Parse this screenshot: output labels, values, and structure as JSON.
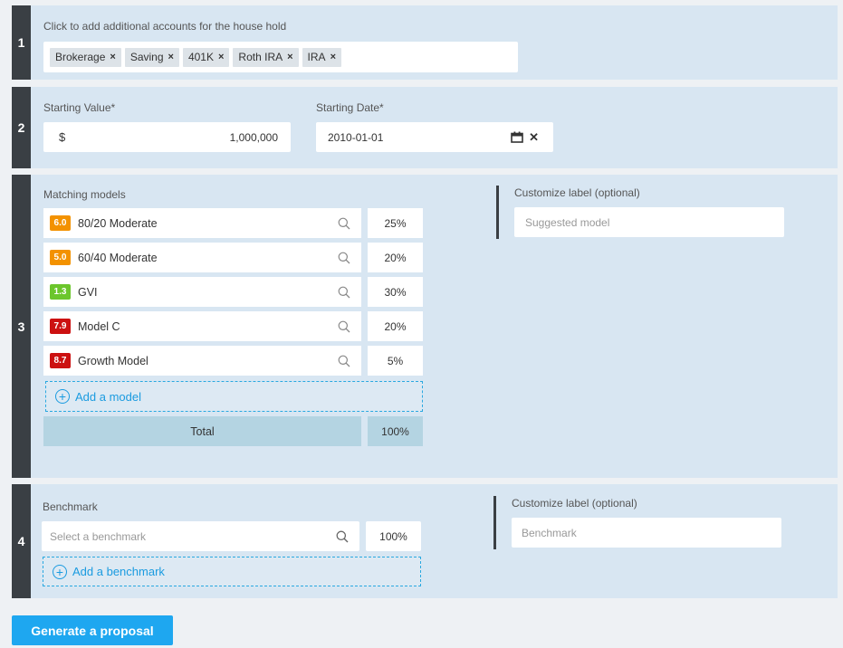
{
  "section1": {
    "step": "1",
    "label": "Click to add additional accounts for the house hold",
    "chips": [
      {
        "label": "Brokerage"
      },
      {
        "label": "Saving"
      },
      {
        "label": "401K"
      },
      {
        "label": "Roth IRA"
      },
      {
        "label": "IRA"
      }
    ],
    "chip_remove_glyph": "×"
  },
  "section2": {
    "step": "2",
    "starting_value_label": "Starting Value*",
    "currency_symbol": "$",
    "starting_value": "1,000,000",
    "starting_date_label": "Starting Date*",
    "starting_date": "2010-01-01",
    "calendar_icon": "calendar-icon",
    "clear_icon": "close-icon"
  },
  "section3": {
    "step": "3",
    "label": "Matching models",
    "models": [
      {
        "score": "6.0",
        "name": "80/20 Moderate",
        "pct": "25%",
        "color": "#f39200"
      },
      {
        "score": "5.0",
        "name": "60/40 Moderate",
        "pct": "20%",
        "color": "#f39200"
      },
      {
        "score": "1.3",
        "name": "GVI",
        "pct": "30%",
        "color": "#6cc62c"
      },
      {
        "score": "7.9",
        "name": "Model C",
        "pct": "20%",
        "color": "#cc1111"
      },
      {
        "score": "8.7",
        "name": "Growth Model",
        "pct": "5%",
        "color": "#cc1111"
      }
    ],
    "add_model_label": "Add a model",
    "total_label": "Total",
    "total_pct": "100%",
    "customize_label": "Customize label (optional)",
    "customize_placeholder": "Suggested model"
  },
  "section4": {
    "step": "4",
    "label": "Benchmark",
    "benchmark_placeholder": "Select a benchmark",
    "benchmark_pct": "100%",
    "add_benchmark_label": "Add a benchmark",
    "customize_label": "Customize label (optional)",
    "customize_placeholder": "Benchmark"
  },
  "generate_button": "Generate a proposal",
  "colors": {
    "accent": "#1ea7f0",
    "section_bg": "#d8e6f2",
    "step_bg": "#3a3f44",
    "total_bg": "#b4d4e2"
  }
}
